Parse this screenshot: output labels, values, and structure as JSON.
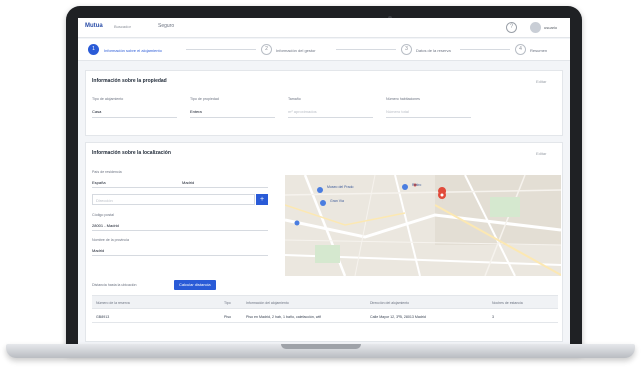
{
  "header": {
    "logo": "Mutua",
    "logo_sub": "Buscador",
    "search_label": "Seguro",
    "user_name": "usuario"
  },
  "stepper": {
    "steps": [
      {
        "index": "1",
        "label": "Información sobre el alojamiento",
        "active": true
      },
      {
        "index": "2",
        "label": "Información del gestor",
        "active": false
      },
      {
        "index": "3",
        "label": "Datos de la reserva",
        "active": false
      },
      {
        "index": "4",
        "label": "Resumen",
        "active": false
      }
    ]
  },
  "property_card": {
    "title": "Información sobre la propiedad",
    "edit_link": "Editar",
    "fields": [
      {
        "label": "Tipo de alojamiento",
        "value": "Casa",
        "placeholder": ""
      },
      {
        "label": "Tipo de propiedad",
        "value": "Entera",
        "placeholder": ""
      },
      {
        "label": "Tamaño",
        "value": "",
        "placeholder": "m² aproximados"
      },
      {
        "label": "Número habitaciones",
        "value": "",
        "placeholder": "Número total"
      }
    ]
  },
  "location_card": {
    "title": "Información sobre la localización",
    "edit_link": "Editar",
    "country_label": "País de residencia",
    "country_value": "España",
    "region_value": "Madrid",
    "address_placeholder": "Dirección",
    "add_button": "+",
    "postal_label": "Código postal",
    "postal_value": "28001 - Madrid",
    "province_label": "Nombre de la provincia",
    "province_value": "Madrid",
    "distance_label": "Distancia hasta la ubicación",
    "calc_button": "Calcular distancia",
    "map_labels": {
      "poi_1": "Museo del Prado",
      "poi_2": "Gran Vía",
      "poi_3": "Retiro"
    }
  },
  "table": {
    "headers": [
      "Número de la reserva",
      "Tipo",
      "Información del alojamiento",
      "Dirección del alojamiento",
      "Noches de estancia"
    ],
    "rows": [
      {
        "id": "GB8913",
        "type": "Piso",
        "info": "Piso en Madrid, 2 hab, 1 baño, calefacción, wifi",
        "address": "Calle Mayor 12, 3ºB, 28013 Madrid",
        "nights": "3"
      }
    ]
  }
}
